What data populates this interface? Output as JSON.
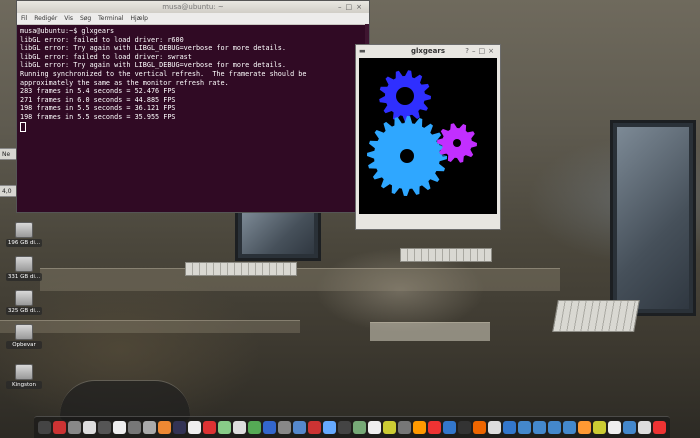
{
  "terminal": {
    "title": "musa@ubuntu: ~",
    "menu": [
      "Fil",
      "Redigér",
      "Vis",
      "Søg",
      "Terminal",
      "Hjælp"
    ],
    "lines": [
      "musa@ubuntu:~$ glxgears",
      "libGL error: failed to load driver: r600",
      "libGL error: Try again with LIBGL_DEBUG=verbose for more details.",
      "libGL error: failed to load driver: swrast",
      "libGL error: Try again with LIBGL_DEBUG=verbose for more details.",
      "Running synchronized to the vertical refresh.  The framerate should be",
      "approximately the same as the monitor refresh rate.",
      "283 frames in 5.4 seconds = 52.476 FPS",
      "271 frames in 6.0 seconds = 44.885 FPS",
      "198 frames in 5.5 seconds = 36.121 FPS",
      "198 frames in 5.5 seconds = 35.955 FPS"
    ]
  },
  "glxgears": {
    "title": "glxgears",
    "gear_colors": {
      "red_gear": "#2f2fff",
      "green_gear": "#2fa7ff",
      "blue_gear": "#c22fff"
    }
  },
  "desktop_icons": [
    {
      "label": "196 GB di..."
    },
    {
      "label": "331 GB di..."
    },
    {
      "label": "325 GB di..."
    },
    {
      "label": "Opbevar"
    },
    {
      "label": "Kingston"
    }
  ],
  "left_tabs": [
    "Ne",
    "4,0"
  ],
  "dock": {
    "colors": [
      "#444",
      "#c33",
      "#888",
      "#ddd",
      "#555",
      "#eee",
      "#777",
      "#aaa",
      "#e83",
      "#335",
      "#eee",
      "#d33",
      "#8c8",
      "#ddd",
      "#5a5",
      "#36c",
      "#888",
      "#58c",
      "#c33",
      "#6af",
      "#444",
      "#7a7",
      "#eee",
      "#cc3",
      "#777",
      "#f90",
      "#e33",
      "#37c",
      "#333",
      "#e60",
      "#ddd",
      "#37c",
      "#48c",
      "#48c",
      "#48c",
      "#48c",
      "#f93",
      "#cc3",
      "#eee",
      "#48c",
      "#ddd",
      "#e33"
    ]
  }
}
